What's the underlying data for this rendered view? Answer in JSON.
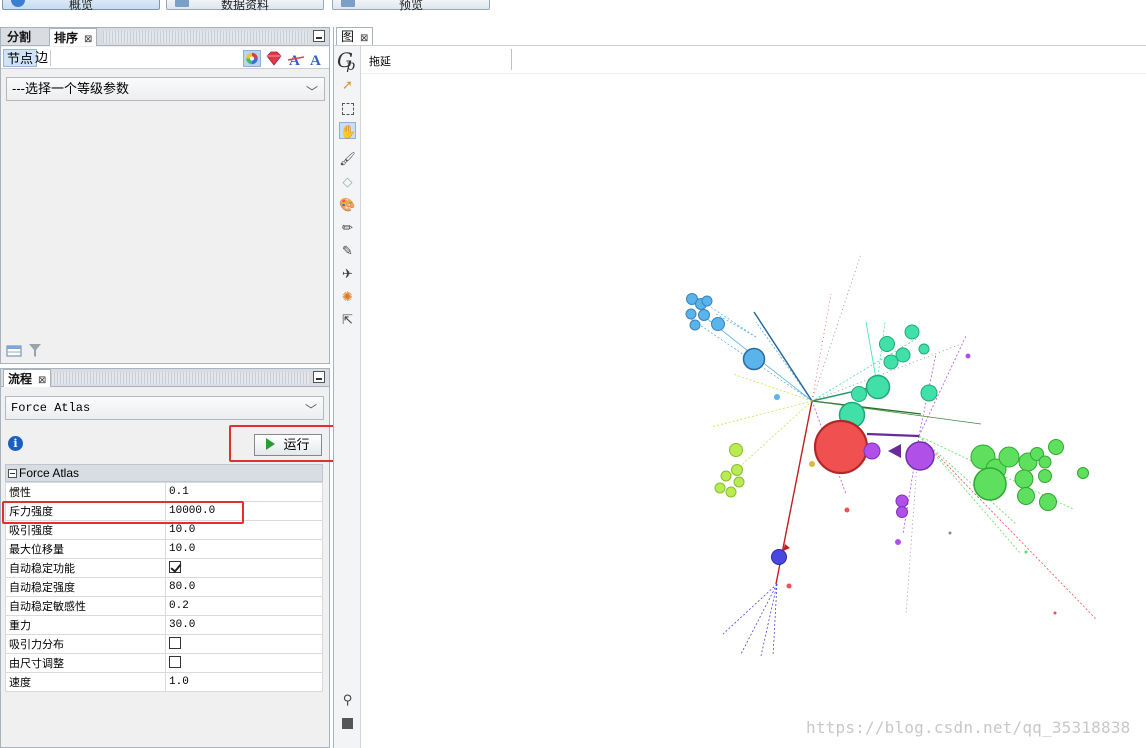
{
  "top_tabs": [
    "概览",
    "数据资料",
    "预览"
  ],
  "ranking_panel": {
    "tabs": [
      {
        "label": "分割"
      },
      {
        "label": "排序"
      }
    ],
    "subtabs": [
      "节点",
      "边"
    ],
    "combo_value": "---选择一个等级参数"
  },
  "layout_panel": {
    "tab": "流程",
    "combo_value": "Force Atlas",
    "run_label": "运行",
    "section_title": "Force Atlas",
    "properties": [
      {
        "name": "惯性",
        "value": "0.1"
      },
      {
        "name": "斥力强度",
        "value": "10000.0"
      },
      {
        "name": "吸引强度",
        "value": "10.0"
      },
      {
        "name": "最大位移量",
        "value": "10.0"
      },
      {
        "name": "自动稳定功能",
        "checked": true
      },
      {
        "name": "自动稳定强度",
        "value": "80.0"
      },
      {
        "name": "自动稳定敏感性",
        "value": "0.2"
      },
      {
        "name": "重力",
        "value": "30.0"
      },
      {
        "name": "吸引力分布",
        "checked": false
      },
      {
        "name": "由尺寸调整",
        "checked": false
      },
      {
        "name": "速度",
        "value": "1.0"
      }
    ]
  },
  "graph_panel": {
    "tab": "图",
    "toolbar_label": "拖延",
    "node_colors": {
      "red": "#f05050",
      "purple": "#b050e8",
      "green": "#5ee05e",
      "teal": "#40e0a8",
      "blue": "#5ab4ec",
      "lime": "#b8ec50",
      "navy": "#4848e0"
    }
  },
  "watermark": "https://blog.csdn.net/qq_35318838"
}
